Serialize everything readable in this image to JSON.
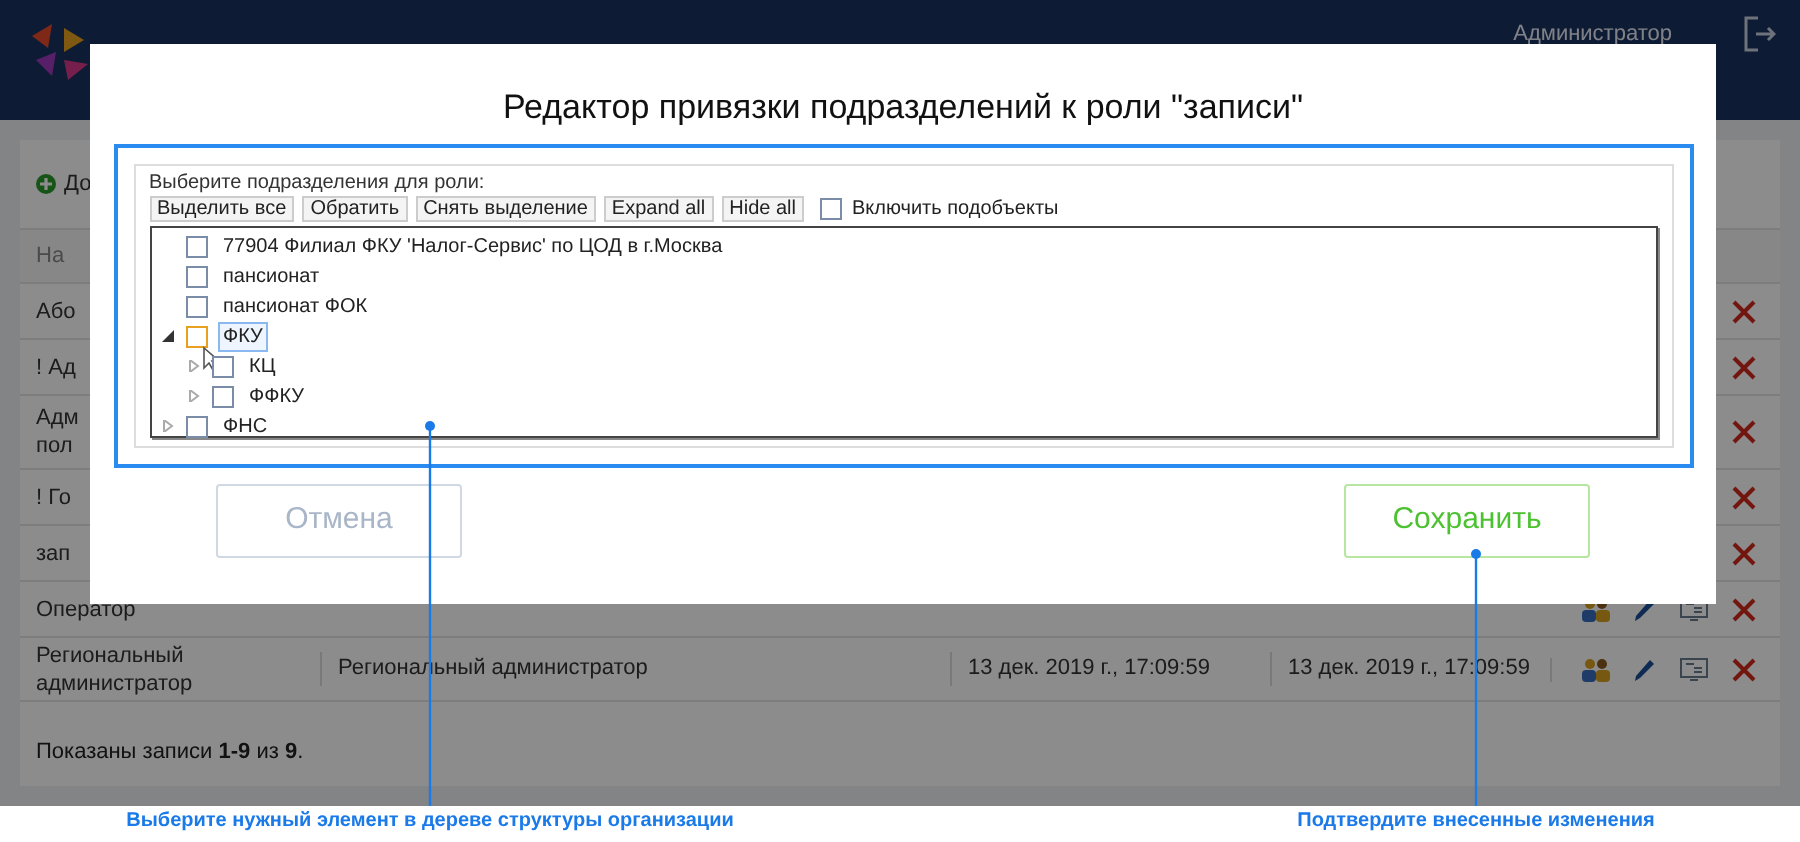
{
  "header": {
    "user": "Администратор"
  },
  "page": {
    "add_button": "До",
    "table": {
      "header": "На",
      "rows": [
        {
          "kind": "covered",
          "name": [
            "Або"
          ]
        },
        {
          "kind": "covered",
          "name": [
            "! Ад"
          ]
        },
        {
          "kind": "covered",
          "name": [
            "Адм",
            "пол"
          ]
        },
        {
          "kind": "covered",
          "name": [
            "! Го"
          ]
        },
        {
          "kind": "covered",
          "name": [
            "зап"
          ]
        },
        {
          "kind": "partial",
          "name": [
            "Оператор"
          ]
        },
        {
          "kind": "full",
          "name": [
            "Региональный",
            "администратор"
          ],
          "description": "Региональный администратор",
          "created": "13 дек. 2019 г., 17:09:59",
          "modified": "13 дек. 2019 г., 17:09:59"
        }
      ]
    },
    "footer": "Показаны записи **1-9** из **9**."
  },
  "dialog": {
    "title": "Редактор привязки подразделений к роли \"записи\"",
    "prompt": "Выберите подразделения для роли:",
    "toolbar": [
      "Выделить все",
      "Обратить",
      "Снять выделение",
      "Expand all",
      "Hide all"
    ],
    "include_subobjects": {
      "label": "Включить подобъекты",
      "checked": false
    },
    "tree": [
      {
        "label": "77904 Филиал ФКУ 'Налог-Сервис' по ЦОД в г.Москва",
        "checked": false,
        "focused": false
      },
      {
        "label": "пансионат",
        "checked": false,
        "focused": false
      },
      {
        "label": "пансионат ФОК",
        "checked": false,
        "focused": false
      },
      {
        "label": "ФКУ",
        "checked": false,
        "focused": true,
        "expanded": true,
        "children": [
          {
            "label": "КЦ",
            "checked": false,
            "focused": false,
            "expanded": false
          },
          {
            "label": "ФФКУ",
            "checked": false,
            "focused": false,
            "expanded": false
          }
        ]
      },
      {
        "label": "ФНС",
        "checked": false,
        "focused": false,
        "expanded": false
      }
    ],
    "cancel": "Отмена",
    "save": "Сохранить"
  },
  "annotations": [
    "Выберите нужный элемент в дереве структуры организации",
    "Подтвердите внесенные изменения"
  ]
}
